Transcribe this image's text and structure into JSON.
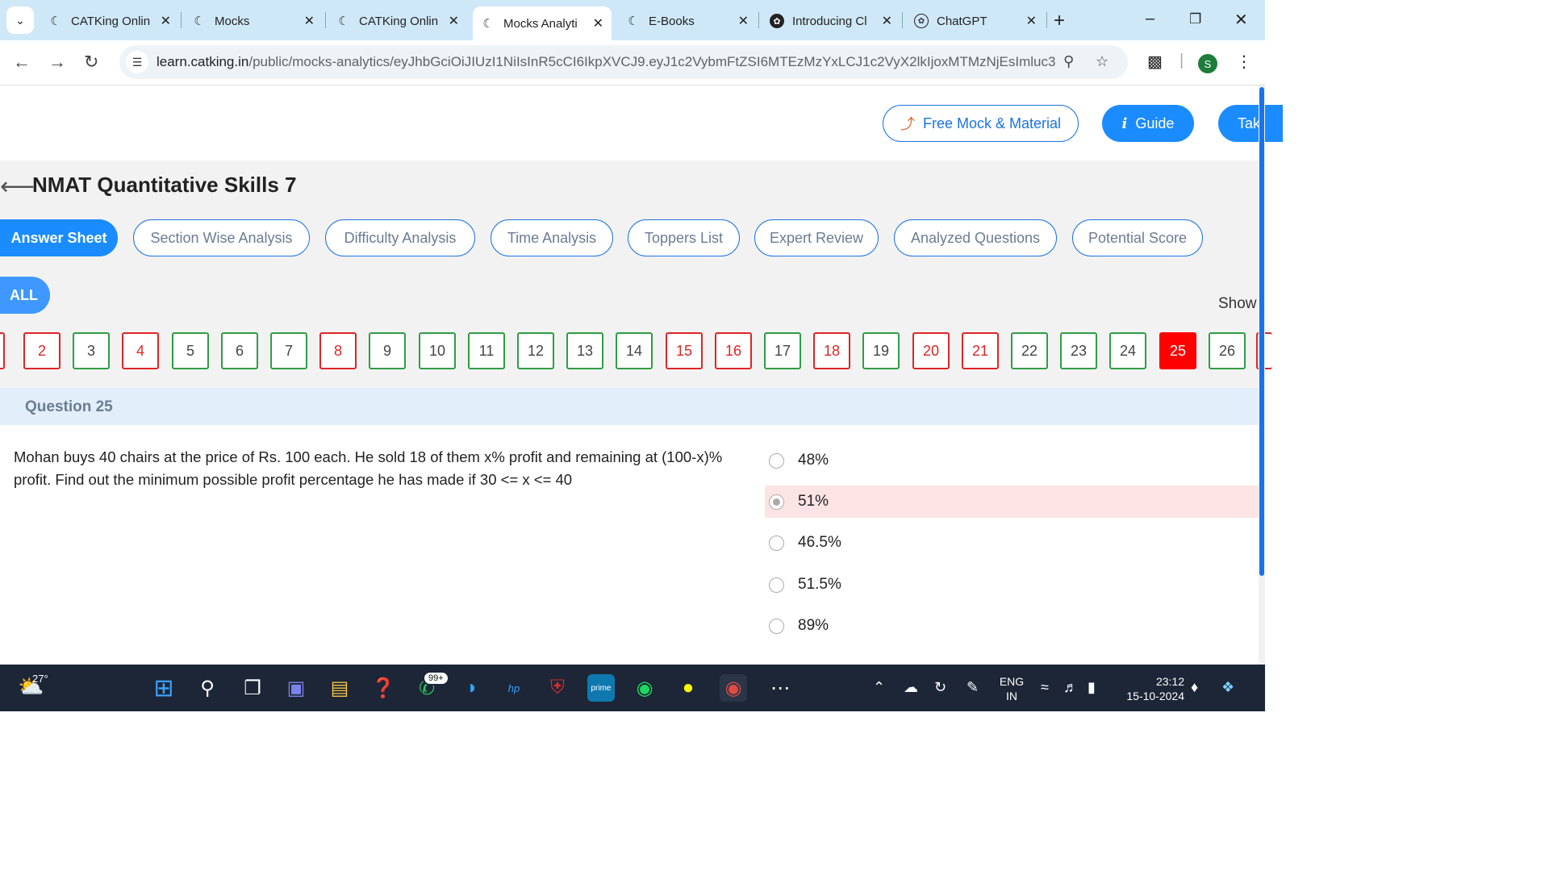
{
  "browser": {
    "tabs": [
      {
        "label": "CATKing Onlin",
        "icon": "catking-icon"
      },
      {
        "label": "Mocks",
        "icon": "catking-icon"
      },
      {
        "label": "CATKing Onlin",
        "icon": "catking-icon"
      },
      {
        "label": "Mocks Analyti",
        "icon": "catking-icon",
        "active": true
      },
      {
        "label": "E-Books",
        "icon": "catking-icon"
      },
      {
        "label": "Introducing Cl",
        "icon": "openai-icon"
      },
      {
        "label": "ChatGPT",
        "icon": "openai-icon"
      }
    ],
    "url_host": "learn.catking.in",
    "url_path": "/public/mocks-analytics/eyJhbGciOiJIUzI1NiIsInR5cCI6IkpXVCJ9.eyJ1c2VybmFtZSI6MTEzMzYxLCJ1c2VyX2lkIjoxMTMzNjEsImluc3Rp...",
    "profile_initial": "S"
  },
  "header": {
    "free_mock_label": "Free Mock & Material",
    "guide_label": "Guide",
    "take_label": "Tak"
  },
  "page": {
    "title": "NMAT Quantitative Skills 7",
    "tabs": [
      "Answer Sheet",
      "Section Wise Analysis",
      "Difficulty Analysis",
      "Time Analysis",
      "Toppers List",
      "Expert Review",
      "Analyzed Questions",
      "Potential Score"
    ],
    "filter_all": "ALL",
    "show_label": "Show"
  },
  "question_nav": [
    {
      "n": "2",
      "status": "red"
    },
    {
      "n": "3",
      "status": "green"
    },
    {
      "n": "4",
      "status": "red"
    },
    {
      "n": "5",
      "status": "green"
    },
    {
      "n": "6",
      "status": "green"
    },
    {
      "n": "7",
      "status": "green"
    },
    {
      "n": "8",
      "status": "red"
    },
    {
      "n": "9",
      "status": "green"
    },
    {
      "n": "10",
      "status": "green"
    },
    {
      "n": "11",
      "status": "green"
    },
    {
      "n": "12",
      "status": "green"
    },
    {
      "n": "13",
      "status": "green"
    },
    {
      "n": "14",
      "status": "green"
    },
    {
      "n": "15",
      "status": "red"
    },
    {
      "n": "16",
      "status": "red"
    },
    {
      "n": "17",
      "status": "green"
    },
    {
      "n": "18",
      "status": "red"
    },
    {
      "n": "19",
      "status": "green"
    },
    {
      "n": "20",
      "status": "red"
    },
    {
      "n": "21",
      "status": "red"
    },
    {
      "n": "22",
      "status": "green"
    },
    {
      "n": "23",
      "status": "green"
    },
    {
      "n": "24",
      "status": "green"
    },
    {
      "n": "25",
      "status": "current"
    },
    {
      "n": "26",
      "status": "green"
    }
  ],
  "question": {
    "label": "Question 25",
    "text": "Mohan buys 40 chairs at the price of Rs. 100 each. He sold 18 of them x% profit and remaining at (100-x)% profit. Find out the minimum possible profit percentage he has made if 30 <= x <= 40",
    "options": [
      {
        "label": "48%"
      },
      {
        "label": "51%",
        "selected": true,
        "wrong": true
      },
      {
        "label": "46.5%"
      },
      {
        "label": "51.5%"
      },
      {
        "label": "89%"
      }
    ]
  },
  "taskbar": {
    "temperature": "27°",
    "whatsapp_badge": "99+",
    "lang_line1": "ENG",
    "lang_line2": "IN",
    "time": "23:12",
    "date": "15-10-2024"
  },
  "colors": {
    "accent": "#1a8cff",
    "wrong": "#e02424",
    "correct": "#2e9e44",
    "wrong_bg": "#fde4e4"
  }
}
